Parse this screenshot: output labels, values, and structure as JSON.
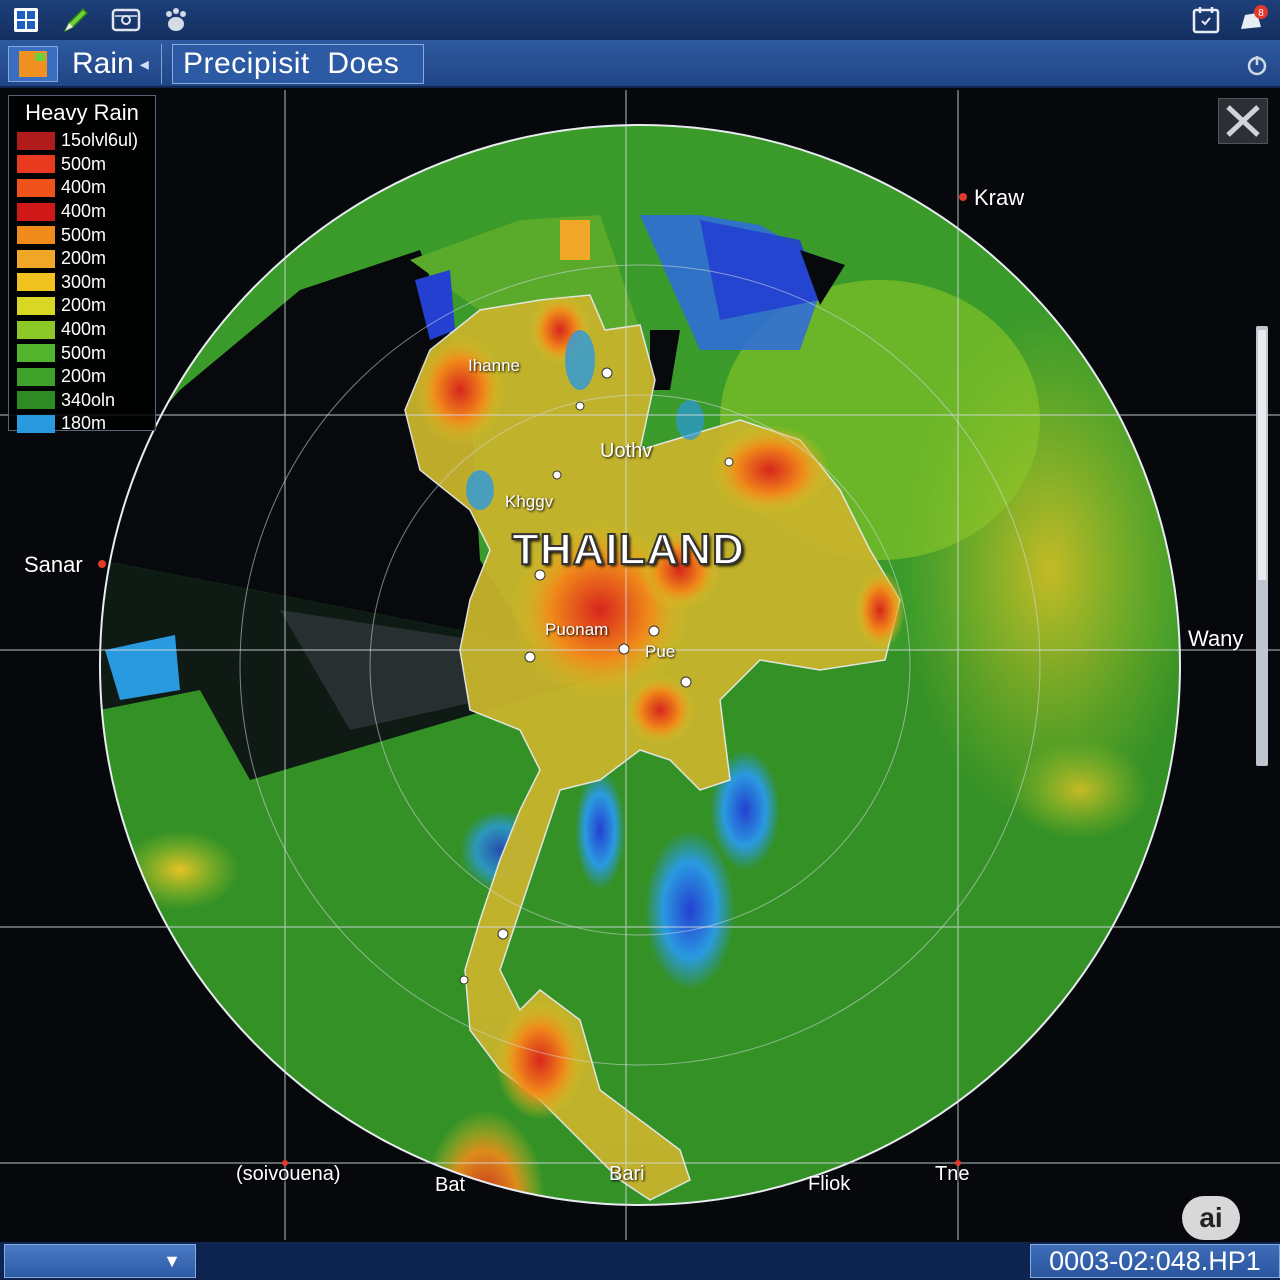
{
  "toolbar": {
    "icons": [
      "grid-icon",
      "pencil-icon",
      "settings-panel-icon",
      "paw-icon",
      "calendar-icon",
      "notification-icon"
    ]
  },
  "tabs": {
    "rain_label": "Rain",
    "precip_label": "Precipisit  Does"
  },
  "legend": {
    "title": "Heavy Rain",
    "items": [
      {
        "label": "15olvl6ul)",
        "color": "#b01c1c"
      },
      {
        "label": "500m",
        "color": "#e83a1e"
      },
      {
        "label": "400m",
        "color": "#f0521c"
      },
      {
        "label": "400m",
        "color": "#d01818"
      },
      {
        "label": "500m",
        "color": "#f08a1a"
      },
      {
        "label": "200m",
        "color": "#f0a626"
      },
      {
        "label": "300m",
        "color": "#f0c21e"
      },
      {
        "label": "200m",
        "color": "#d8d824"
      },
      {
        "label": "400m",
        "color": "#8cc828"
      },
      {
        "label": "500m",
        "color": "#52b42c"
      },
      {
        "label": "200m",
        "color": "#3fa22a"
      },
      {
        "label": "340oln",
        "color": "#2e8a22"
      },
      {
        "label": "180m",
        "color": "#2a9ae0"
      }
    ]
  },
  "map": {
    "country": "THAILAND",
    "edge_labels": {
      "kraw": "Kraw",
      "sanar": "Sanar",
      "wany": "Wany",
      "sipouena": "(soivouena)",
      "bat": "Bat",
      "bari": "Bari",
      "fliok": "Fliok",
      "tne": "Tne"
    },
    "city_labels": {
      "ihanne": "Ihanne",
      "uothv": "Uothv",
      "khggv": "Khggv",
      "puonam": "Puonam",
      "pue": "Pue"
    }
  },
  "badge": "ai",
  "status": {
    "timestamp": "0003-02:048.HP1"
  },
  "colors": {
    "toolbar": "#1d3f7a",
    "tabbar": "#2f5aa0",
    "radar_green": "#3fa22a",
    "radar_red": "#d8261c",
    "radar_blue": "#2a6ee0"
  }
}
